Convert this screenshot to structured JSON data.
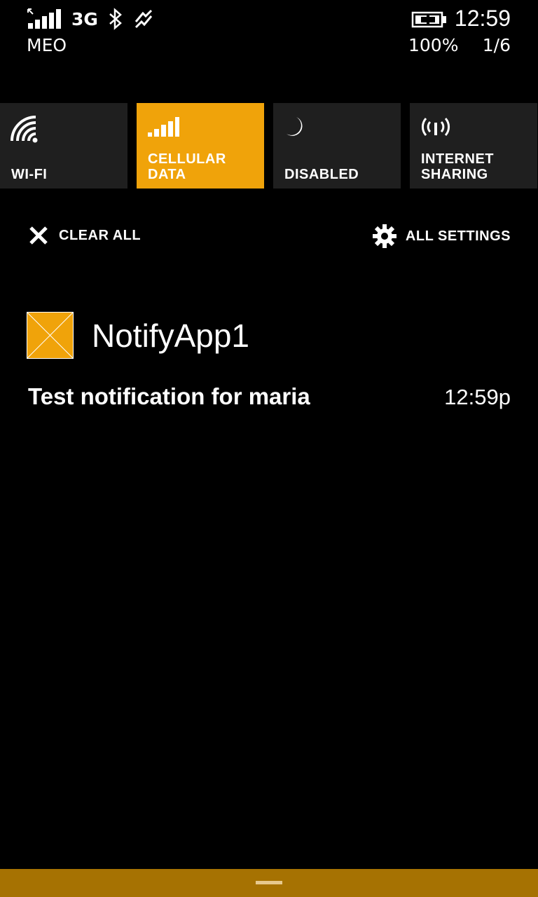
{
  "status_bar": {
    "network_type": "3G",
    "carrier": "MEO",
    "time": "12:59",
    "battery": "100%",
    "page_index": "1/6",
    "icons": [
      "signal-strength-icon",
      "bluetooth-icon",
      "data-sense-icon",
      "battery-charging-icon"
    ]
  },
  "quick_actions": [
    {
      "label": "WI-FI",
      "icon": "wifi-icon",
      "active": false
    },
    {
      "label": "CELLULAR DATA",
      "icon": "cellular-signal-icon",
      "active": true
    },
    {
      "label": "DISABLED",
      "icon": "moon-icon",
      "active": false
    },
    {
      "label": "INTERNET\nSHARING",
      "icon": "internet-sharing-icon",
      "active": false
    }
  ],
  "actions": {
    "clear_all": "CLEAR ALL",
    "all_settings": "ALL SETTINGS"
  },
  "notification_group": {
    "app_name": "NotifyApp1",
    "items": [
      {
        "text": "Test notification for maria",
        "time": "12:59p"
      }
    ]
  },
  "colors": {
    "accent": "#f0a30a",
    "tile_bg": "#1f1f1f",
    "bottom_bar": "#a67202",
    "background": "#000000"
  }
}
